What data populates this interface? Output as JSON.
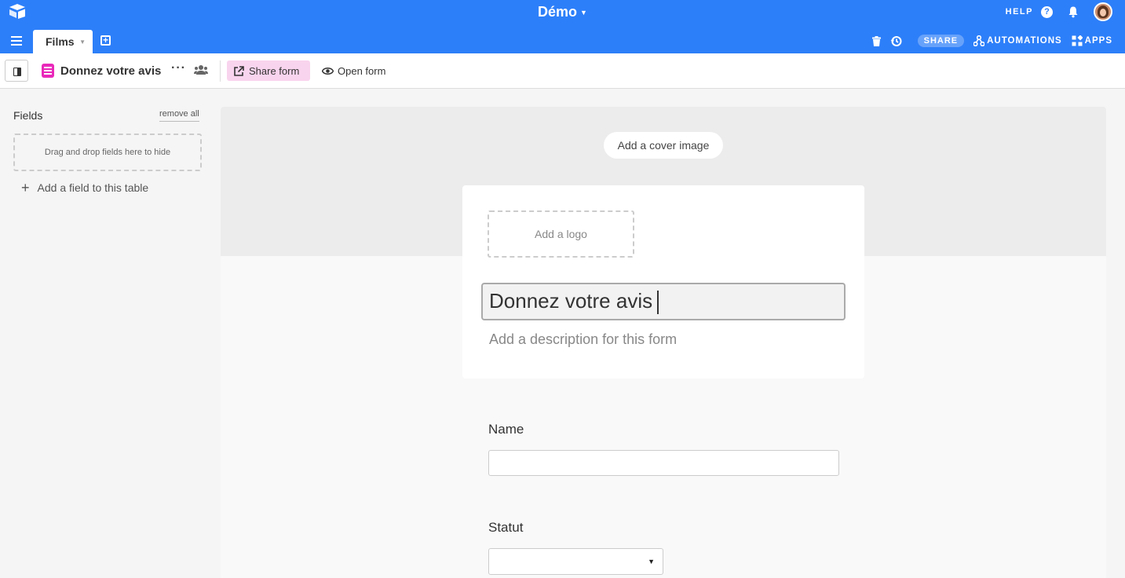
{
  "app": {
    "base_title": "Démo",
    "help_label": "HELP",
    "help_glyph": "?"
  },
  "tabs": [
    {
      "label": "Films"
    }
  ],
  "toolbar": {
    "share_label": "SHARE",
    "automations_label": "AUTOMATIONS",
    "apps_label": "APPS"
  },
  "view": {
    "name": "Donnez votre avis",
    "more_glyph": "···",
    "share_form_label": "Share form",
    "open_form_label": "Open form"
  },
  "sidebar": {
    "title": "Fields",
    "remove_all_label": "remove all",
    "drop_zone_text": "Drag and drop fields here to hide",
    "add_field_label": "Add a field to this table"
  },
  "form": {
    "cover_button_label": "Add a cover image",
    "logo_placeholder": "Add a logo",
    "title_value": "Donnez votre avis",
    "description_placeholder": "Add a description for this form",
    "fields": [
      {
        "label": "Name",
        "type": "text",
        "value": ""
      },
      {
        "label": "Statut",
        "type": "select",
        "value": ""
      }
    ]
  },
  "colors": {
    "brand": "#2d7ff9",
    "view_icon": "#e929ba",
    "share_form_bg": "#f9d4ee"
  }
}
